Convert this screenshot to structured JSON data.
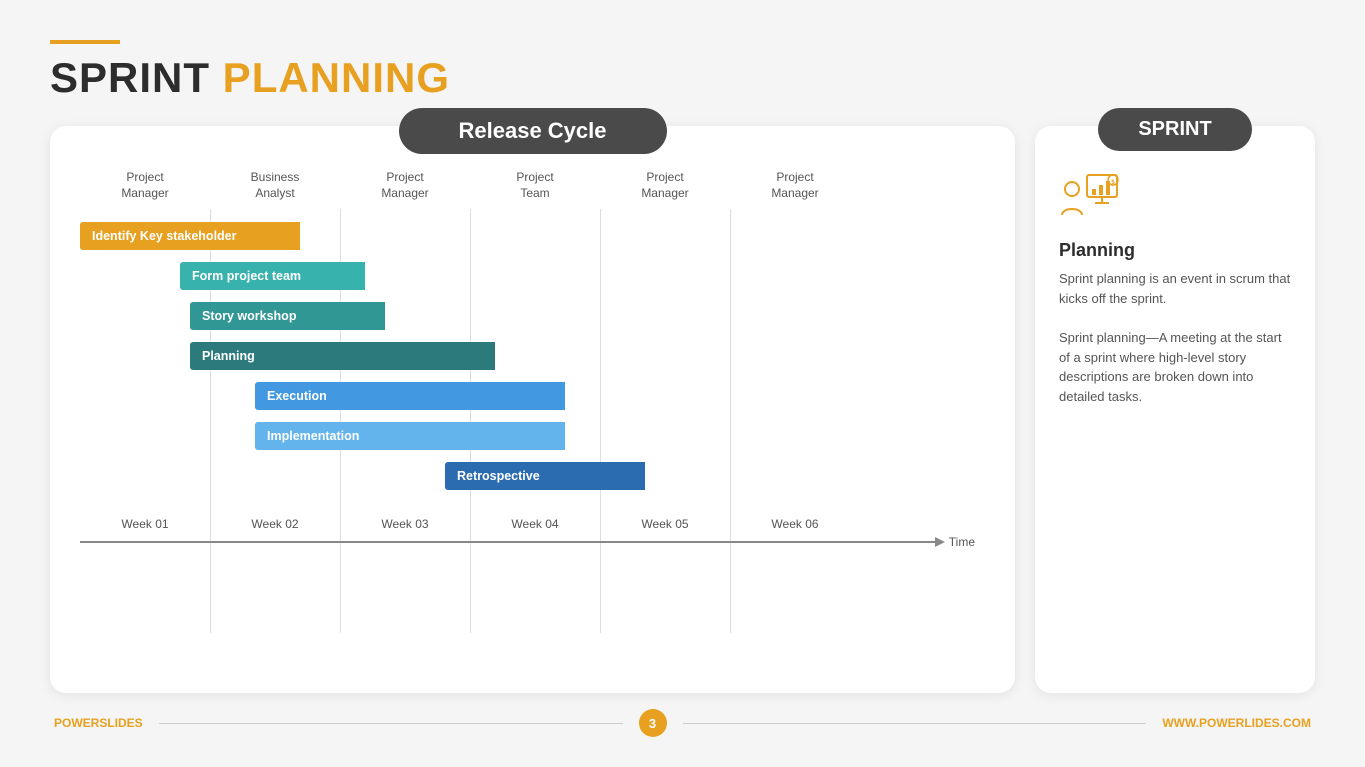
{
  "header": {
    "line_color": "#E8A020",
    "title_black": "SPRINT",
    "title_orange": " PLANNING"
  },
  "release_cycle": {
    "label": "Release Cycle"
  },
  "sprint": {
    "label": "SPRINT"
  },
  "columns": [
    {
      "role": "Project\nManager"
    },
    {
      "role": "Business\nAnalyst"
    },
    {
      "role": "Project\nManager"
    },
    {
      "role": "Project\nTeam"
    },
    {
      "role": "Project\nManager"
    },
    {
      "role": "Project\nManager"
    }
  ],
  "weeks": [
    "Week 01",
    "Week 02",
    "Week 03",
    "Week 04",
    "Week 05",
    "Week 06"
  ],
  "time_label": "Time",
  "bars": [
    {
      "label": "Identify Key stakeholder",
      "color": "#E8A020",
      "arrow_color": "#E8A020",
      "left_pct": 0,
      "width_pct": 30
    },
    {
      "label": "Form project team",
      "color": "#38B2AC",
      "arrow_color": "#38B2AC",
      "left_pct": 12,
      "width_pct": 28
    },
    {
      "label": "Story workshop",
      "color": "#319795",
      "arrow_color": "#319795",
      "left_pct": 14,
      "width_pct": 30
    },
    {
      "label": "Planning",
      "color": "#2C7A7B",
      "arrow_color": "#2C7A7B",
      "left_pct": 14,
      "width_pct": 45
    },
    {
      "label": "Execution",
      "color": "#4299E1",
      "arrow_color": "#4299E1",
      "left_pct": 24,
      "width_pct": 47
    },
    {
      "label": "Implementation",
      "color": "#63B3ED",
      "arrow_color": "#63B3ED",
      "left_pct": 24,
      "width_pct": 47
    },
    {
      "label": "Retrospective",
      "color": "#2B6CB0",
      "arrow_color": "#2B6CB0",
      "left_pct": 52,
      "width_pct": 30
    }
  ],
  "planning_section": {
    "title": "Planning",
    "desc1": "Sprint planning is an event in scrum that kicks off the sprint.",
    "desc2": "Sprint planning—A meeting at the start of a sprint where high-level story descriptions are broken down into detailed tasks."
  },
  "footer": {
    "left_black": "POWER",
    "left_orange": "SLIDES",
    "page_num": "3",
    "right": "WWW.POWERLIDES.COM"
  }
}
